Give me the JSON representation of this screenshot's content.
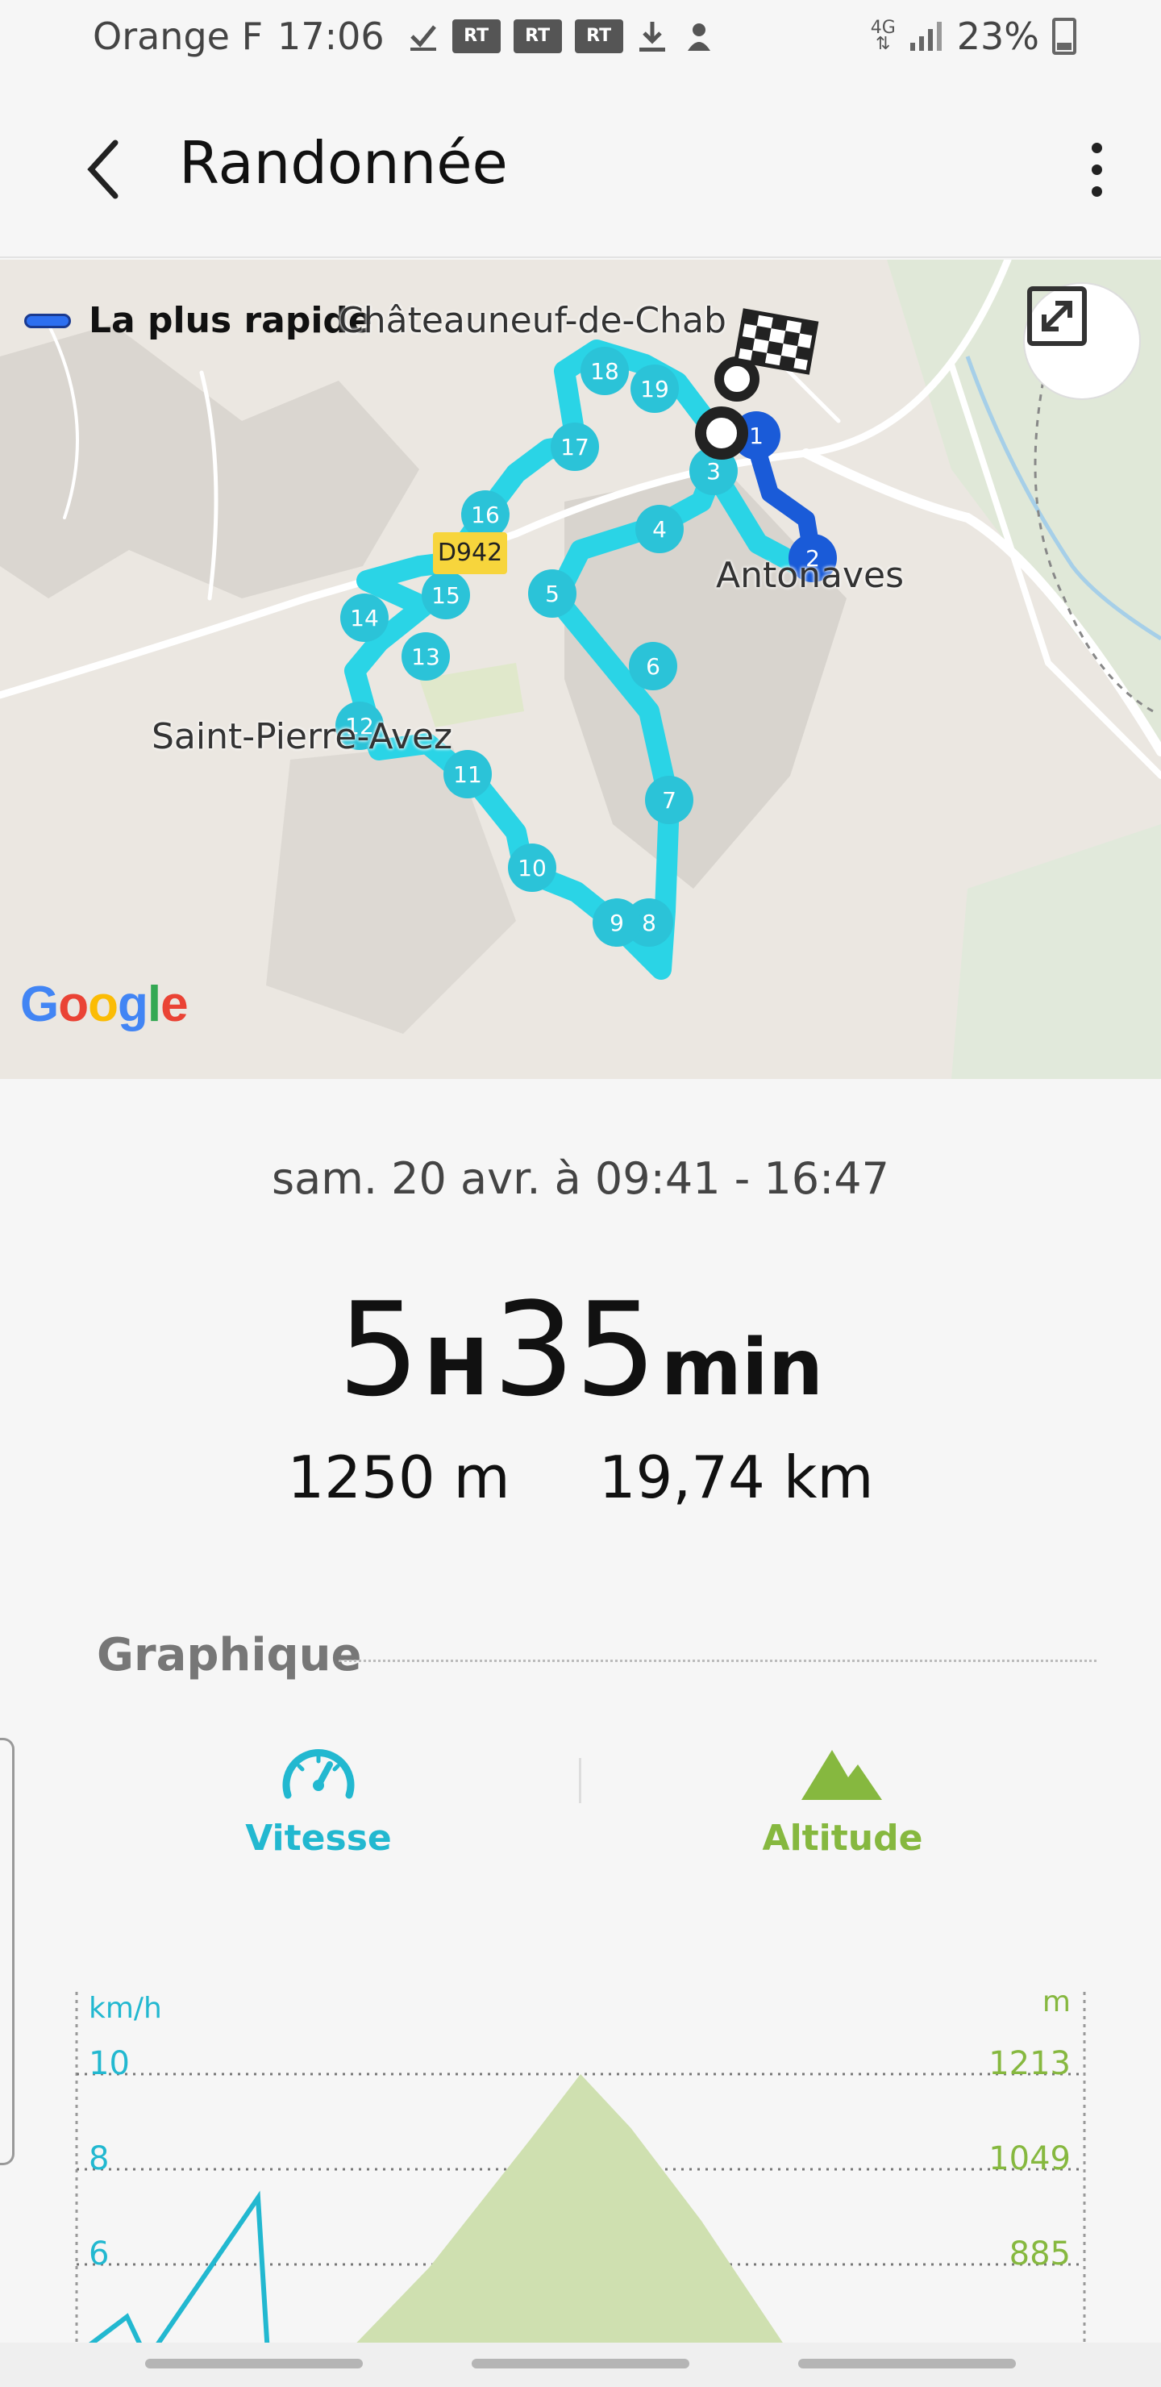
{
  "status_bar": {
    "carrier": "Orange F",
    "time": "17:06",
    "rt_badge": "RT",
    "network": "4G",
    "battery": "23%"
  },
  "app_bar": {
    "title": "Randonnée"
  },
  "map": {
    "legend_label": "La plus rapide",
    "towns": [
      "Châteauneuf-de-Chab",
      "Antonaves",
      "Saint-Pierre-Avez"
    ],
    "road_badge": "D942",
    "route_color": "#2ad4e6",
    "route_start_color": "#1a5bd8",
    "waypoints": [
      "1",
      "2",
      "3",
      "4",
      "5",
      "6",
      "7",
      "8",
      "9",
      "10",
      "11",
      "12",
      "13",
      "14",
      "15",
      "16",
      "17",
      "18",
      "19"
    ],
    "google_letters": [
      "G",
      "o",
      "o",
      "g",
      "l",
      "e"
    ],
    "google_colors": [
      "#4285F4",
      "#EA4335",
      "#FBBC05",
      "#4285F4",
      "#34A853",
      "#EA4335"
    ]
  },
  "summary": {
    "date_range": "sam. 20 avr. à 09:41 - 16:47",
    "duration_hours": "5",
    "hours_unit": "H",
    "duration_minutes": "35",
    "minutes_unit": "min",
    "elevation": "1250 m",
    "distance": "19,74 km"
  },
  "graph_section": {
    "title": "Graphique",
    "tabs": {
      "speed": {
        "label": "Vitesse",
        "icon": "speedometer-icon",
        "color": "#22b8d0"
      },
      "altitude": {
        "label": "Altitude",
        "icon": "mountain-icon",
        "color": "#86b83f"
      }
    }
  },
  "chart_data": {
    "type": "area",
    "left_axis_label": "km/h",
    "right_axis_label": "m",
    "left_ticks": [
      "10",
      "8",
      "6"
    ],
    "right_ticks": [
      "1213",
      "1049",
      "885"
    ],
    "series": [
      {
        "name": "Altitude",
        "axis": "right",
        "color": "#cfe0b0",
        "points": [
          [
            0.25,
            700
          ],
          [
            0.35,
            880
          ],
          [
            0.45,
            1100
          ],
          [
            0.5,
            1213
          ],
          [
            0.55,
            1120
          ],
          [
            0.62,
            960
          ],
          [
            0.72,
            700
          ]
        ]
      },
      {
        "name": "Vitesse",
        "axis": "left",
        "color": "#22b8d0",
        "points": [
          [
            0.0,
            4.1
          ],
          [
            0.05,
            4.9
          ],
          [
            0.07,
            4.0
          ],
          [
            0.18,
            7.4
          ],
          [
            0.19,
            4.0
          ]
        ]
      }
    ]
  }
}
